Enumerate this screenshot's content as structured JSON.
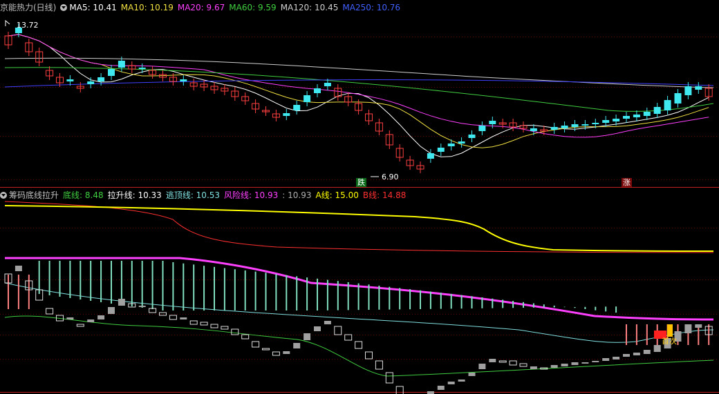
{
  "colors": {
    "up": "#ff4040",
    "down": "#40e8f0",
    "ma5": "#ffffff",
    "ma10": "#f0e040",
    "ma20": "#ff40ff",
    "ma60": "#40d040",
    "ma120": "#d0d0d0",
    "ma250": "#4040ff",
    "dixian": "#40d040",
    "lasheng": "#ffffff",
    "taoding": "#80e0e0",
    "fengxian": "#ff40ff",
    "aline": "#ffff00",
    "bline": "#ff3030"
  },
  "top": {
    "title": "京能热力(日线)",
    "ma5": "MA5: 10.41",
    "ma10": "MA10: 10.19",
    "ma20": "MA20: 9.67",
    "ma60": "MA60: 9.59",
    "ma120": "MA120: 10.45",
    "ma250": "MA250: 10.76",
    "high_label": "13.72",
    "low_label": "6.90",
    "die_tag": "跌",
    "zhang_tag": "涨"
  },
  "bottom": {
    "title": "筹码底线拉升",
    "dixian": "底线: 8.48",
    "lasheng": "拉升线: 10.33",
    "taoding": "逃顶线: 10.53",
    "fengxian": "风险线: 10.93",
    "extra": ": 10.93",
    "aline": "A线: 15.00",
    "bline": "B线: 14.88",
    "sign": "首次"
  },
  "chart_data": [
    {
      "type": "candlestick",
      "title": "京能热力(日线)",
      "series": [
        {
          "name": "MA5",
          "latest": 10.41
        },
        {
          "name": "MA10",
          "latest": 10.19
        },
        {
          "name": "MA20",
          "latest": 9.67
        },
        {
          "name": "MA60",
          "latest": 9.59
        },
        {
          "name": "MA120",
          "latest": 10.45
        },
        {
          "name": "MA250",
          "latest": 10.76
        }
      ],
      "annotations": [
        "13.72",
        "6.90",
        "跌",
        "涨"
      ],
      "high": 13.72,
      "low": 6.9
    },
    {
      "type": "line",
      "title": "筹码底线拉升",
      "series": [
        {
          "name": "底线",
          "latest": 8.48
        },
        {
          "name": "拉升线",
          "latest": 10.33
        },
        {
          "name": "逃顶线",
          "latest": 10.53
        },
        {
          "name": "风险线",
          "latest": 10.93
        },
        {
          "name": "A线",
          "latest": 15.0
        },
        {
          "name": "B线",
          "latest": 14.88
        }
      ],
      "annotations": [
        "首次"
      ]
    }
  ]
}
